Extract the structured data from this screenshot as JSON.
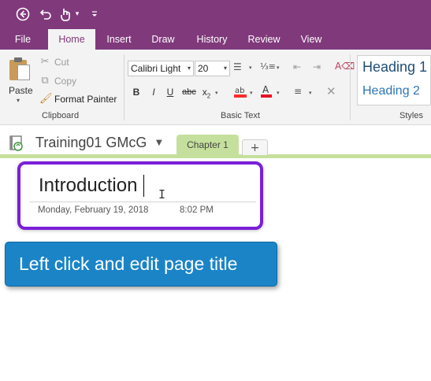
{
  "quick_access": {
    "icons": [
      "back-arrow-icon",
      "undo-icon",
      "touch-mode-icon",
      "customize-toolbar-icon"
    ]
  },
  "tabs": [
    "File",
    "Home",
    "Insert",
    "Draw",
    "History",
    "Review",
    "View"
  ],
  "active_tab": "Home",
  "ribbon": {
    "clipboard": {
      "paste_label": "Paste",
      "cut_label": "Cut",
      "copy_label": "Copy",
      "format_painter_label": "Format Painter",
      "group_label": "Clipboard"
    },
    "basic_text": {
      "font_name": "Calibri Light",
      "font_size": "20",
      "bold": "B",
      "italic": "I",
      "underline": "U",
      "strikethrough": "abc",
      "subscript": "x",
      "group_label": "Basic Text"
    },
    "styles": {
      "heading1": "Heading 1",
      "heading2": "Heading 2",
      "group_label": "Styles"
    }
  },
  "notebook": {
    "name": "Training01 GMcG",
    "section_tab": "Chapter 1",
    "add_section": "+"
  },
  "page": {
    "title": "Introduction",
    "date": "Monday, February 19, 2018",
    "time": "8:02 PM"
  },
  "callout": {
    "text": "Left click and edit page title"
  },
  "colors": {
    "onenote_purple": "#80397b",
    "section_green": "#c5e09c",
    "highlight_purple": "#7b1fd9",
    "callout_blue": "#1a84c7"
  }
}
